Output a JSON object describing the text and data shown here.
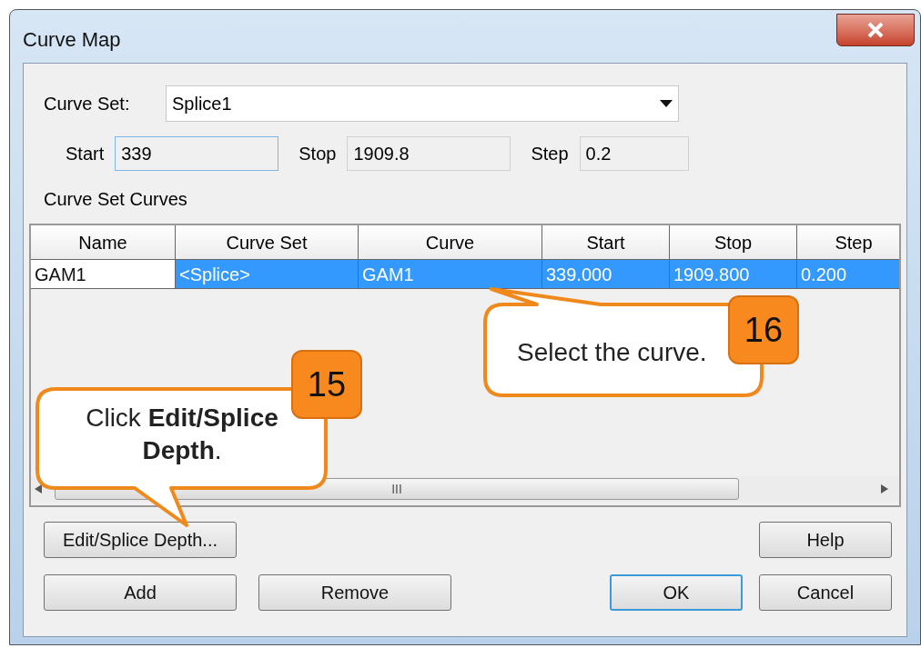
{
  "window": {
    "title": "Curve Map"
  },
  "curve_set": {
    "label": "Curve Set:",
    "value": "Splice1"
  },
  "range_fields": [
    {
      "label": "Start",
      "value": "339",
      "focused": true
    },
    {
      "label": "Stop",
      "value": "1909.8",
      "focused": false
    },
    {
      "label": "Step",
      "value": "0.2",
      "focused": false
    }
  ],
  "table": {
    "title": "Curve Set Curves",
    "columns": [
      "Name",
      "Curve Set",
      "Curve",
      "Start",
      "Stop",
      "Step"
    ],
    "rows": [
      {
        "cells": [
          "GAM1",
          "<Splice>",
          "GAM1",
          "339.000",
          "1909.800",
          "0.200"
        ],
        "selected": true
      }
    ],
    "scrollbar_grip": "III"
  },
  "button_rows": [
    {
      "left": [
        {
          "label": "Edit/Splice Depth...",
          "default": false
        }
      ],
      "right": [
        {
          "label": "Help",
          "default": false
        }
      ]
    },
    {
      "left": [
        {
          "label": "Add",
          "default": false
        },
        {
          "label": "Remove",
          "default": false
        }
      ],
      "right": [
        {
          "label": "OK",
          "default": true
        },
        {
          "label": "Cancel",
          "default": false
        }
      ]
    }
  ],
  "callouts": [
    {
      "step": "15",
      "text": "Click **Edit/Splice Depth**."
    },
    {
      "step": "16",
      "text": "Select the curve."
    }
  ]
}
